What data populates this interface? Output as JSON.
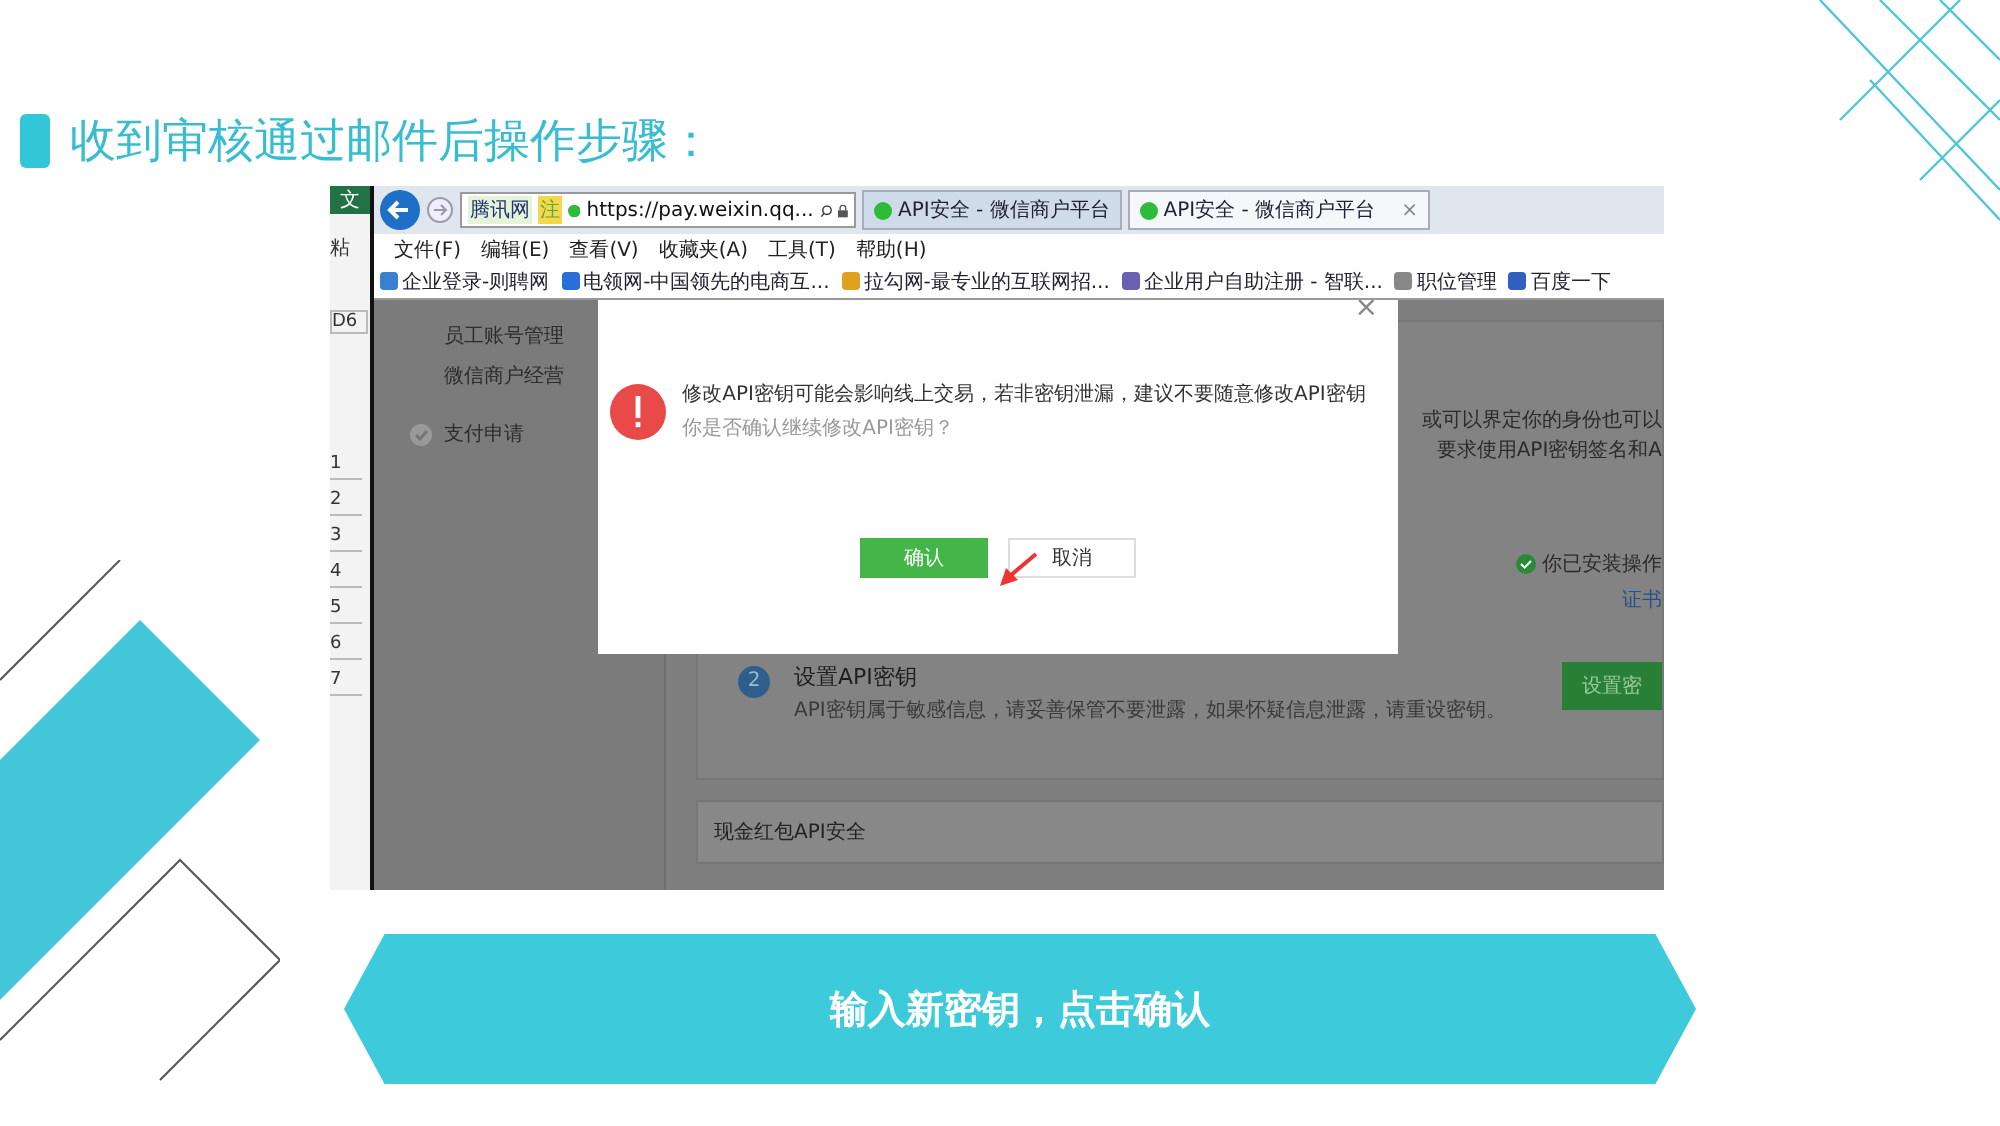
{
  "slide_title": "收到审核通过邮件后操作步骤：",
  "excel": {
    "tab": "文",
    "paste": "粘",
    "cell": "D6",
    "rows": [
      "1",
      "2",
      "3",
      "4",
      "5",
      "6",
      "7"
    ]
  },
  "browser": {
    "site": "腾讯网",
    "badge": "注",
    "url": "https://pay.weixin.qq...",
    "tabs": [
      {
        "label": "API安全 - 微信商户平台",
        "selected": false
      },
      {
        "label": "API安全 - 微信商户平台",
        "selected": true
      }
    ],
    "tab_close": "×",
    "menu": [
      "文件(F)",
      "编辑(E)",
      "查看(V)",
      "收藏夹(A)",
      "工具(T)",
      "帮助(H)"
    ],
    "favorites": [
      "企业登录-则聘网",
      "电领网-中国领先的电商互...",
      "拉勾网-最专业的互联网招...",
      "企业用户自助注册 - 智联...",
      "职位管理",
      "百度一下"
    ]
  },
  "sidebar": {
    "items": [
      {
        "label": "员工账号管理",
        "kind": "link"
      },
      {
        "label": "微信商户经营",
        "kind": "link"
      },
      {
        "label": "支付申请",
        "kind": "section"
      }
    ]
  },
  "page": {
    "side_text": [
      "或可以界定你的身份也可以",
      "要求使用API密钥签名和A"
    ],
    "installed": "你已安装操作",
    "cert_link": "证书",
    "step": {
      "number": "2",
      "title": "设置API密钥",
      "desc": "API密钥属于敏感信息，请妥善保管不要泄露，如果怀疑信息泄露，请重设密钥。"
    },
    "set_key_button": "设置密",
    "section_title": "现金红包API安全"
  },
  "dialog": {
    "close": "×",
    "message": "修改API密钥可能会影响线上交易，若非密钥泄漏，建议不要随意修改API密钥",
    "question": "你是否确认继续修改API密钥？",
    "buttons": [
      {
        "label": "确认",
        "kind": "primary"
      },
      {
        "label": "取消",
        "kind": "default"
      }
    ]
  },
  "banner": {
    "text": "输入新密钥，点击确认"
  }
}
